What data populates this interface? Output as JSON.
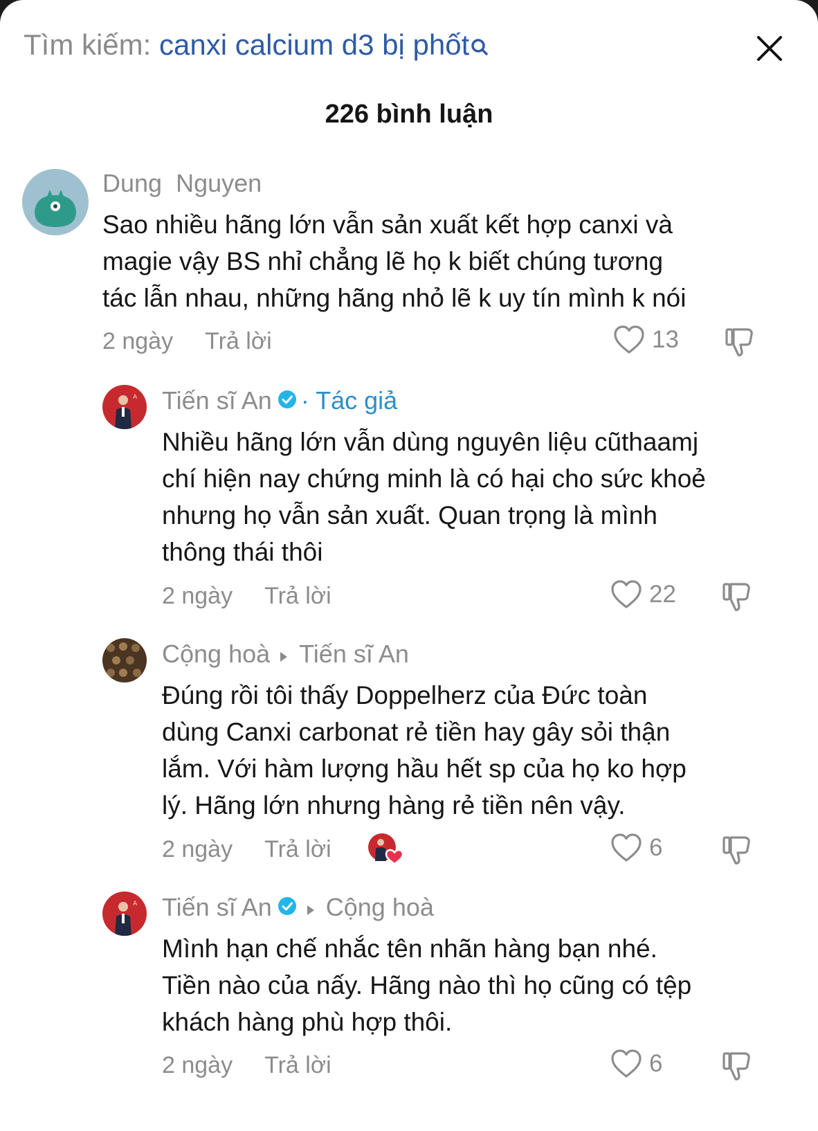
{
  "search": {
    "prefix": "Tìm kiếm: ",
    "query": "canxi calcium d3 bị phốt"
  },
  "comments_count": "226 bình luận",
  "colors": {
    "link_blue": "#2f5aa6",
    "tag_blue": "#2b8fc9",
    "text_gray": "#8c8c8c",
    "text_dark": "#161616",
    "liked_heart": "#e8304f"
  },
  "comments": [
    {
      "author": "Dung  Nguyen",
      "lines": [
        "Sao nhiều hãng lớn vẫn sản xuất kết hợp canxi và",
        "magie vậy BS nhỉ chẳng lẽ họ k biết chúng tương",
        "tác lẫn nhau, những hãng nhỏ lẽ k uy tín mình k nói"
      ],
      "time": "2 ngày",
      "reply": "Trả lời",
      "likes": "13"
    },
    {
      "author": "Tiến sĩ An",
      "tag": "· Tác giả",
      "lines": [
        "Nhiều hãng lớn vẫn dùng nguyên liệu cũthaamj",
        "chí hiện nay chứng minh là có hại cho sức khoẻ",
        "nhưng họ vẫn sản xuất. Quan trọng là mình",
        "thông thái thôi"
      ],
      "time": "2 ngày",
      "reply": "Trả lời",
      "likes": "22"
    },
    {
      "author": "Cộng hoà",
      "reply_to": "Tiến sĩ An",
      "lines": [
        "Đúng rồi tôi thấy Doppelherz của Đức toàn",
        "dùng Canxi carbonat rẻ tiền hay gây sỏi thận",
        "lắm. Với hàm lượng hầu hết sp của họ ko hợp",
        "lý. Hãng lớn nhưng hàng rẻ tiền nên vậy."
      ],
      "time": "2 ngày",
      "reply": "Trả lời",
      "likes": "6"
    },
    {
      "author": "Tiến sĩ An",
      "reply_to": "Cộng hoà",
      "lines": [
        "Mình hạn chế nhắc tên nhãn hàng bạn nhé.",
        "Tiền nào của nấy. Hãng nào thì họ cũng có tệp",
        "khách hàng phù hợp thôi."
      ],
      "time": "2 ngày",
      "reply": "Trả lời",
      "likes": "6"
    }
  ]
}
